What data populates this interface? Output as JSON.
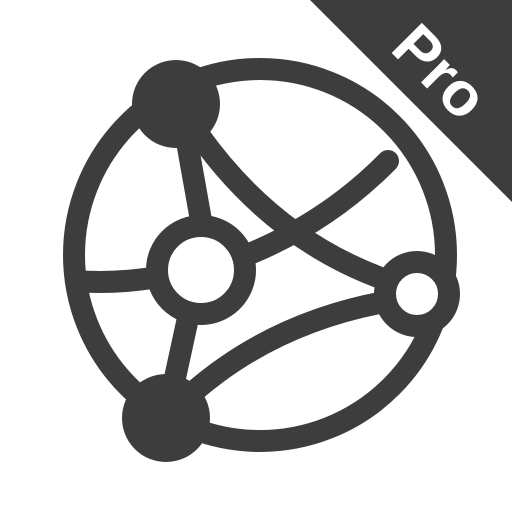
{
  "icon": {
    "name": "network-globe-icon",
    "color": "#3d3d3d",
    "background": "#ffffff"
  },
  "badge": {
    "label": "Pro",
    "background": "#3d3d3d",
    "text_color": "#ffffff"
  }
}
